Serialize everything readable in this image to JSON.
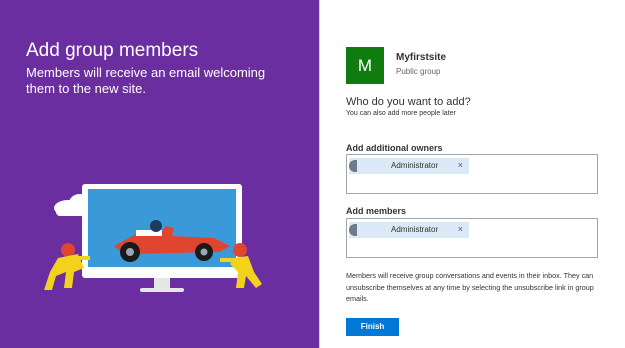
{
  "left": {
    "title": "Add group members",
    "subtitle": "Members will receive an email welcoming them to the new site.",
    "background_color": "#6a2ea0"
  },
  "site": {
    "tile_letter": "M",
    "tile_color": "#107c10",
    "name": "Myfirstsite",
    "type": "Public group"
  },
  "form": {
    "question": "Who do you want to add?",
    "question_sub": "You can also add more people later",
    "owners": {
      "label": "Add additional owners",
      "people": [
        {
          "name": "Administrator",
          "remove_icon": "×"
        }
      ]
    },
    "members": {
      "label": "Add members",
      "people": [
        {
          "name": "Administrator",
          "remove_icon": "×"
        }
      ]
    },
    "info_text": "Members will receive group conversations and events in their inbox. They can unsubscribe themselves at any time by selecting the unsubscribe link in group emails.",
    "finish_label": "Finish",
    "accent_color": "#0078d4"
  }
}
